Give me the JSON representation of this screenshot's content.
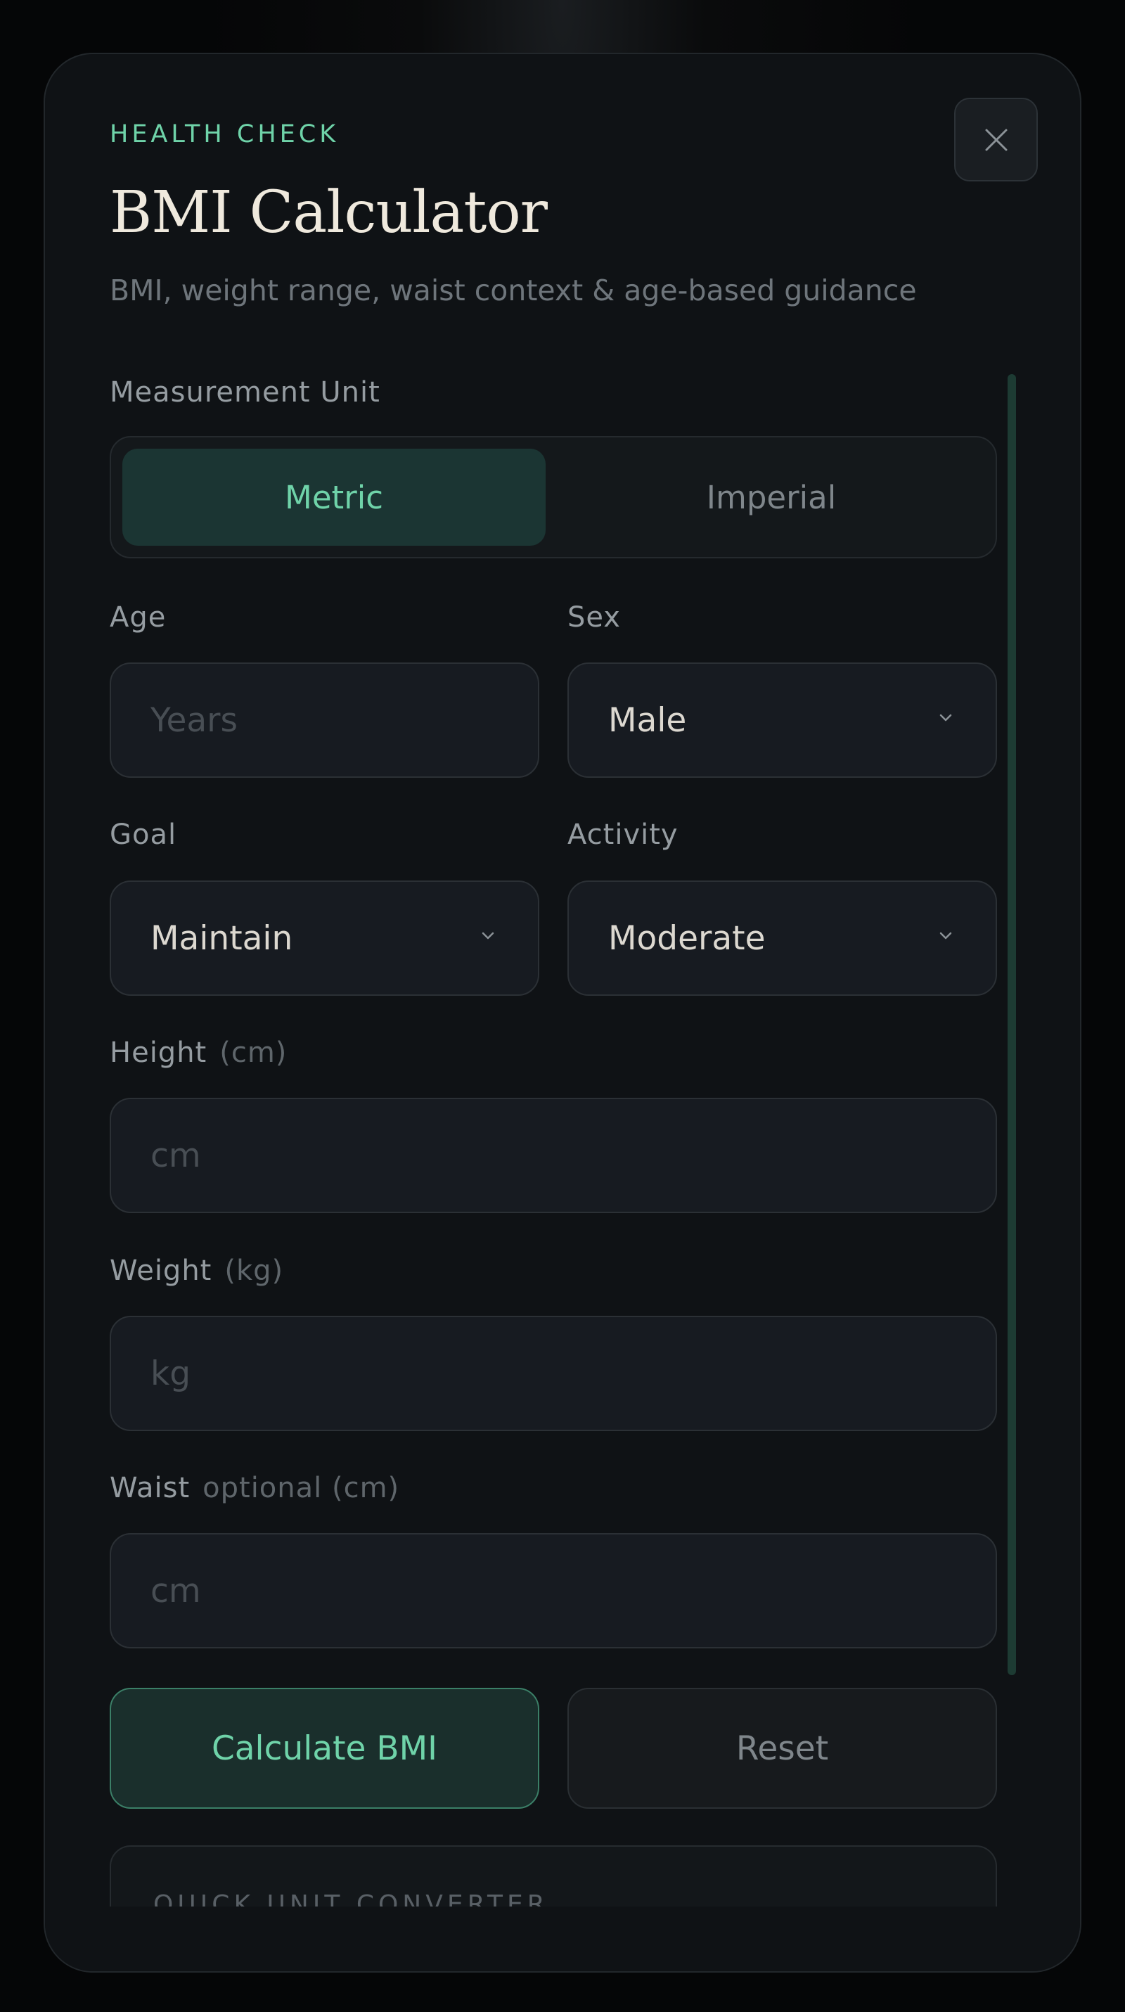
{
  "modal": {
    "eyebrow": "HEALTH CHECK",
    "title": "BMI Calculator",
    "subtitle": "BMI, weight range, waist context & age-based guidance",
    "close_icon": "close-icon"
  },
  "unit": {
    "label": "Measurement Unit",
    "options": [
      "Metric",
      "Imperial"
    ],
    "selected": "Metric"
  },
  "age": {
    "label": "Age",
    "placeholder": "Years"
  },
  "sex": {
    "label": "Sex",
    "value": "Male"
  },
  "goal": {
    "label": "Goal",
    "value": "Maintain"
  },
  "activity": {
    "label": "Activity",
    "value": "Moderate"
  },
  "height": {
    "label": "Height",
    "unit_hint": "(cm)",
    "placeholder": "cm"
  },
  "weight": {
    "label": "Weight",
    "unit_hint": "(kg)",
    "placeholder": "kg"
  },
  "waist": {
    "label": "Waist",
    "unit_hint": "optional (cm)",
    "placeholder": "cm"
  },
  "actions": {
    "calculate": "Calculate BMI",
    "reset": "Reset"
  },
  "converter": {
    "title": "QUICK UNIT CONVERTER"
  },
  "colors": {
    "accent": "#6fd3a9",
    "background": "#0f1215"
  }
}
